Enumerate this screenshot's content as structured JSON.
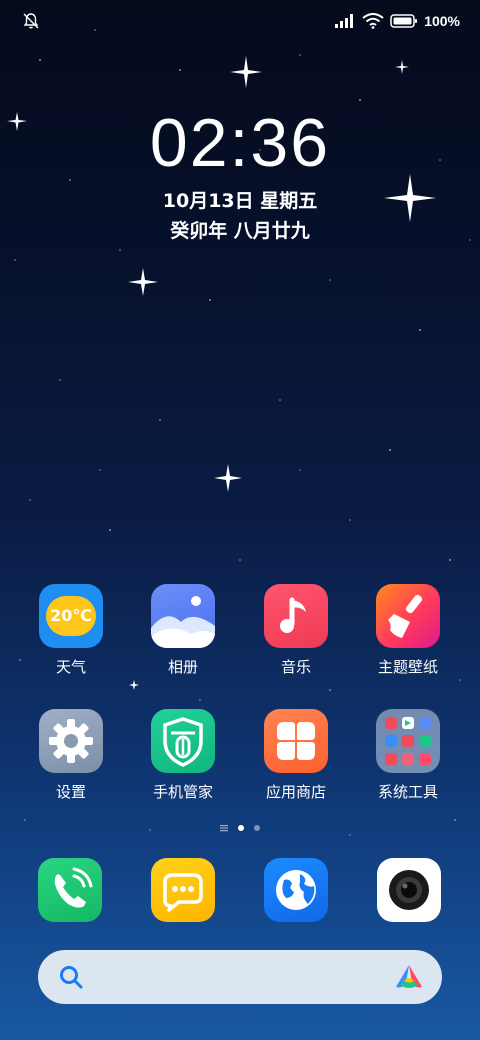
{
  "status_bar": {
    "battery_text": "100%",
    "icons": [
      "bell-off-icon",
      "signal-icon",
      "wifi-icon",
      "battery-icon"
    ]
  },
  "lock_clock": {
    "time": "02:36",
    "date": "10月13日 星期五",
    "lunar": "癸卯年 八月廿九"
  },
  "apps_row1": [
    {
      "label": "天气",
      "icon": "weather-icon",
      "badge": "20℃"
    },
    {
      "label": "相册",
      "icon": "gallery-icon"
    },
    {
      "label": "音乐",
      "icon": "music-icon"
    },
    {
      "label": "主题壁纸",
      "icon": "theme-icon"
    }
  ],
  "apps_row2": [
    {
      "label": "设置",
      "icon": "settings-icon"
    },
    {
      "label": "手机管家",
      "icon": "security-icon"
    },
    {
      "label": "应用商店",
      "icon": "app-store-icon"
    },
    {
      "label": "系统工具",
      "icon": "folder-icon"
    }
  ],
  "pager": {
    "pages": 2,
    "active": 1
  },
  "dock": [
    "phone-icon",
    "messages-icon",
    "browser-icon",
    "camera-icon"
  ],
  "colors": {
    "weather": "#1e8ff0",
    "gallery": "#5a8cf5",
    "music": "#f0455e",
    "theme": "#ff5a3c",
    "settings": "#8a9bb0",
    "security": "#1ec68c",
    "store": "#ff7040",
    "phone": "#1ec873",
    "messages": "#ffc400",
    "browser": "#1a7cf5",
    "camera": "#ffffff"
  }
}
